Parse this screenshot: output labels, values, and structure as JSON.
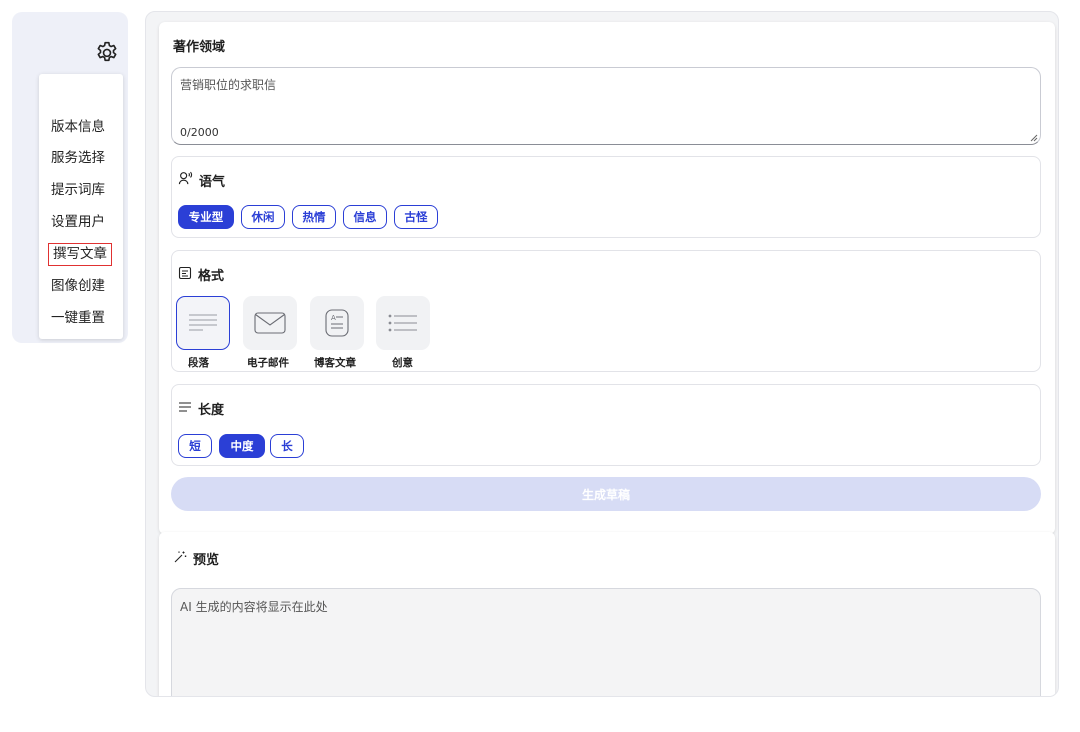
{
  "sidebar": {
    "settings_icon": "gear-icon",
    "menu": [
      {
        "label": "版本信息"
      },
      {
        "label": "服务选择"
      },
      {
        "label": "提示词库"
      },
      {
        "label": "设置用户"
      },
      {
        "label": "撰写文章",
        "active": true
      },
      {
        "label": "图像创建"
      },
      {
        "label": "一键重置"
      }
    ]
  },
  "writing_area": {
    "label": "著作领域",
    "value": "营销职位的求职信",
    "char_count": "0/2000"
  },
  "tone": {
    "label": "语气",
    "icon": "speech-icon",
    "options": [
      "专业型",
      "休闲",
      "热情",
      "信息",
      "古怪"
    ],
    "selected": "专业型"
  },
  "format": {
    "label": "格式",
    "icon": "document-icon",
    "options": [
      {
        "label": "段落",
        "icon": "paragraph-icon"
      },
      {
        "label": "电子邮件",
        "icon": "mail-icon"
      },
      {
        "label": "博客文章",
        "icon": "blog-icon"
      },
      {
        "label": "创意",
        "icon": "list-icon"
      }
    ],
    "selected": "段落"
  },
  "length": {
    "label": "长度",
    "icon": "lines-icon",
    "options": [
      "短",
      "中度",
      "长"
    ],
    "selected": "中度"
  },
  "generate_button": "生成草稿",
  "preview": {
    "label": "预览",
    "icon": "magic-wand-icon",
    "placeholder": "AI 生成的内容将显示在此处"
  },
  "colors": {
    "accent": "#2b3fd6",
    "generate_disabled": "#d7dcf5",
    "active_outline": "#e03131"
  }
}
